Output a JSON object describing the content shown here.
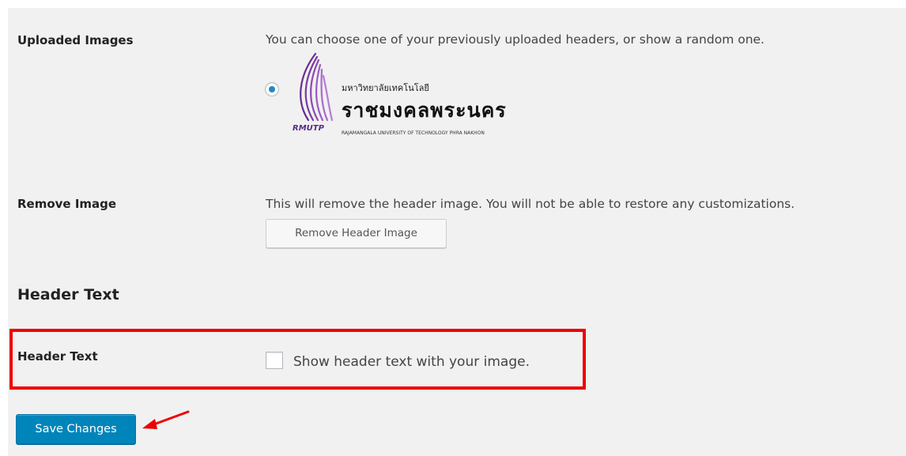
{
  "rows": {
    "uploaded_images": {
      "label": "Uploaded Images",
      "description": "You can choose one of your previously uploaded headers, or show a random one."
    },
    "remove_image": {
      "label": "Remove Image",
      "description": "This will remove the header image. You will not be able to restore any customizations.",
      "button_label": "Remove Header Image"
    },
    "header_text_section": {
      "title": "Header Text"
    },
    "header_text": {
      "label": "Header Text",
      "checkbox_label": "Show header text with your image.",
      "checked": false
    }
  },
  "logo": {
    "thai_small": "มหาวิทยาลัยเทคโนโลยี",
    "thai_large": "ราชมงคลพระนคร",
    "english": "RAJAMANGALA UNIVERSITY OF TECHNOLOGY PHRA NAKHON",
    "brand": "RMUTP",
    "selected": true
  },
  "actions": {
    "save_label": "Save Changes"
  },
  "colors": {
    "primary_button": "#0085ba",
    "highlight_box": "#ee0000",
    "annotation_arrow": "#ee0000",
    "logo_purple": "#5b2a86",
    "panel_background": "#f1f1f1"
  },
  "icons": {
    "radio": "radio-selected-icon",
    "arrow": "annotation-arrow-icon",
    "logo_mark": "flame-logo-icon"
  }
}
